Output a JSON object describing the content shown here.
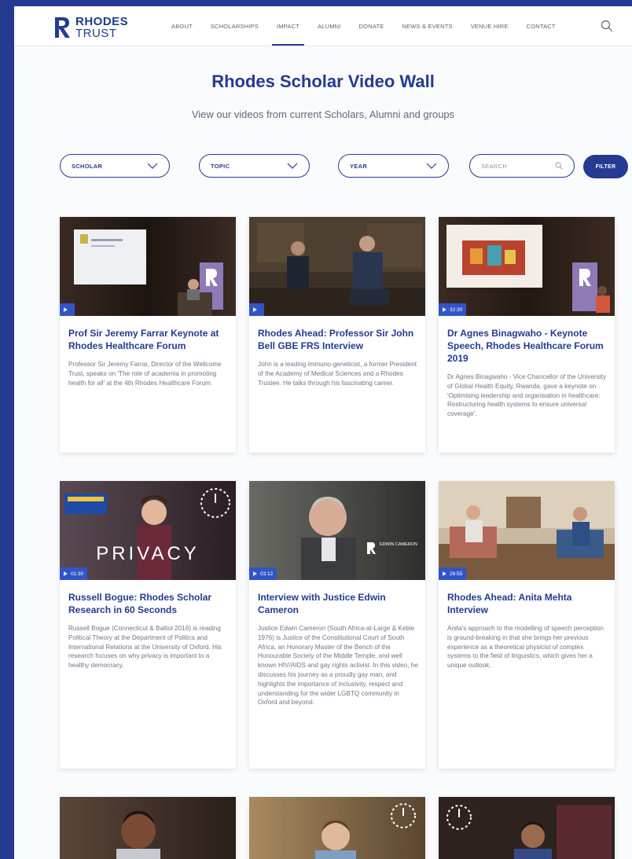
{
  "brand": {
    "line1": "RHODES",
    "line2": "TRUST"
  },
  "nav": [
    {
      "label": "ABOUT",
      "active": false
    },
    {
      "label": "SCHOLARSHIPS",
      "active": false
    },
    {
      "label": "IMPACT",
      "active": true
    },
    {
      "label": "ALUMNI",
      "active": false
    },
    {
      "label": "DONATE",
      "active": false
    },
    {
      "label": "NEWS & EVENTS",
      "active": false
    },
    {
      "label": "VENUE HIRE",
      "active": false
    },
    {
      "label": "CONTACT",
      "active": false
    }
  ],
  "hero": {
    "title": "Rhodes Scholar Video Wall",
    "subtitle": "View our videos from current Scholars, Alumni and groups"
  },
  "filters": {
    "scholar": "SCHOLAR",
    "topic": "TOPIC",
    "year": "YEAR",
    "search_placeholder": "SEARCH",
    "button": "FILTER"
  },
  "colors": {
    "brand": "#253a91",
    "badge": "#3354c4"
  },
  "cards": [
    {
      "title": "Prof Sir Jeremy Farrar Keynote at Rhodes Healthcare Forum",
      "desc": "Professor Sir Jeremy Farrar, Director of the Wellcome Trust, speaks on 'The role of academia in promoting health for all' at the 4th Rhodes Healthcare Forum.",
      "duration": ""
    },
    {
      "title": "Rhodes Ahead: Professor Sir John Bell GBE FRS Interview",
      "desc": "John is a leading immuno-geneticist, a former President of the Academy of Medical Sciences and a Rhodes Trustee. He talks through his fascinating career.",
      "duration": ""
    },
    {
      "title": "Dr Agnes Binagwaho - Keynote Speech, Rhodes Healthcare Forum 2019",
      "desc": "Dr Agnes Binagwaho - Vice Chancellor of the University of Global Health Equity, Rwanda, gave a keynote on 'Optimising leadership and organisation in healthcare: Restructuring health systems to ensure universal coverage'.",
      "duration": "32:30"
    },
    {
      "title": "Russell Bogue: Rhodes Scholar Research in 60 Seconds",
      "desc": "Russell Bogue (Connecticut & Balliol 2016) is reading Political Theory at the Department of Politics and International Relations at the University of Oxford. His research focuses on why privacy is important to a healthy democracy.",
      "duration": "01:30",
      "overlay": "PRIVACY"
    },
    {
      "title": "Interview with Justice Edwin Cameron",
      "desc": "Justice Edwin Cameron (South Africa-at-Large & Keble 1976) is Justice of the Constitutional Court of South Africa, an Honorary Master of the Bench of the Honourable Society of the Middle Temple, and well known HIV/AIDS and gay rights activist. In this video, he discusses his journey as a proudly gay man, and highlights the importance of inclusivity, respect and understanding for the wider LGBTQ community in Oxford and beyond.",
      "duration": "03:12",
      "overlay": "EDWIN CAMERON"
    },
    {
      "title": "Rhodes Ahead: Anita Mehta Interview",
      "desc": "Anita's approach to the modelling of speech perception is ground-breaking in that she brings her previous experience as a theoretical physicist of complex systems to the field of linguistics, which gives her a unique outlook.",
      "duration": "26:55"
    }
  ]
}
